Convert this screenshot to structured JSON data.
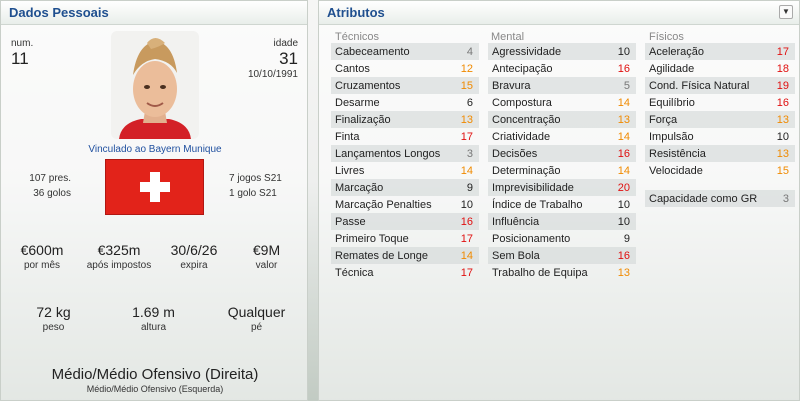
{
  "left": {
    "title": "Dados Pessoais",
    "num_label": "num.",
    "num": "11",
    "age_label": "idade",
    "age": "31",
    "dob": "10/10/1991",
    "club": "Vinculado ao Bayern Munique",
    "caps": "107 pres.",
    "goals": "36 golos",
    "u21_caps": "7 jogos S21",
    "u21_goals": "1 golo S21",
    "wage": "€600m",
    "wage_label": "por mês",
    "net": "€325m",
    "net_label": "após impostos",
    "expires": "30/6/26",
    "expires_label": "expira",
    "value": "€9M",
    "value_label": "valor",
    "weight": "72 kg",
    "weight_label": "peso",
    "height": "1.69 m",
    "height_label": "altura",
    "foot": "Qualquer",
    "foot_label": "pé",
    "position": "Médio/Médio Ofensivo (Direita)",
    "position2": "Médio/Médio Ofensivo (Esquerda)"
  },
  "right": {
    "title": "Atributos",
    "tecnicos": {
      "heading": "Técnicos",
      "items": [
        {
          "name": "Cabeceamento",
          "value": "4",
          "color": "grey"
        },
        {
          "name": "Cantos",
          "value": "12",
          "color": "orange"
        },
        {
          "name": "Cruzamentos",
          "value": "15",
          "color": "orange"
        },
        {
          "name": "Desarme",
          "value": "6",
          "color": "black"
        },
        {
          "name": "Finalização",
          "value": "13",
          "color": "orange"
        },
        {
          "name": "Finta",
          "value": "17",
          "color": "red"
        },
        {
          "name": "Lançamentos Longos",
          "value": "3",
          "color": "grey"
        },
        {
          "name": "Livres",
          "value": "14",
          "color": "orange"
        },
        {
          "name": "Marcação",
          "value": "9",
          "color": "black"
        },
        {
          "name": "Marcação Penalties",
          "value": "10",
          "color": "black"
        },
        {
          "name": "Passe",
          "value": "16",
          "color": "red"
        },
        {
          "name": "Primeiro Toque",
          "value": "17",
          "color": "red"
        },
        {
          "name": "Remates de Longe",
          "value": "14",
          "color": "orange"
        },
        {
          "name": "Técnica",
          "value": "17",
          "color": "red"
        }
      ]
    },
    "mental": {
      "heading": "Mental",
      "items": [
        {
          "name": "Agressividade",
          "value": "10",
          "color": "black"
        },
        {
          "name": "Antecipação",
          "value": "16",
          "color": "red"
        },
        {
          "name": "Bravura",
          "value": "5",
          "color": "grey"
        },
        {
          "name": "Compostura",
          "value": "14",
          "color": "orange"
        },
        {
          "name": "Concentração",
          "value": "13",
          "color": "orange"
        },
        {
          "name": "Criatividade",
          "value": "14",
          "color": "orange"
        },
        {
          "name": "Decisões",
          "value": "16",
          "color": "red"
        },
        {
          "name": "Determinação",
          "value": "14",
          "color": "orange"
        },
        {
          "name": "Imprevisibilidade",
          "value": "20",
          "color": "red"
        },
        {
          "name": "Índice de Trabalho",
          "value": "10",
          "color": "black"
        },
        {
          "name": "Influência",
          "value": "10",
          "color": "black"
        },
        {
          "name": "Posicionamento",
          "value": "9",
          "color": "black"
        },
        {
          "name": "Sem Bola",
          "value": "16",
          "color": "red"
        },
        {
          "name": "Trabalho de Equipa",
          "value": "13",
          "color": "orange"
        }
      ]
    },
    "fisicos": {
      "heading": "Físicos",
      "items": [
        {
          "name": "Aceleração",
          "value": "17",
          "color": "red"
        },
        {
          "name": "Agilidade",
          "value": "18",
          "color": "red"
        },
        {
          "name": "Cond. Física Natural",
          "value": "19",
          "color": "red"
        },
        {
          "name": "Equilíbrio",
          "value": "16",
          "color": "red"
        },
        {
          "name": "Força",
          "value": "13",
          "color": "orange"
        },
        {
          "name": "Impulsão",
          "value": "10",
          "color": "black"
        },
        {
          "name": "Resistência",
          "value": "13",
          "color": "orange"
        },
        {
          "name": "Velocidade",
          "value": "15",
          "color": "orange"
        }
      ]
    },
    "gk": {
      "name": "Capacidade como GR",
      "value": "3",
      "color": "grey"
    }
  },
  "colors": {
    "red": "#e01010",
    "orange": "#f08a00",
    "grey": "#777777",
    "black": "#222222",
    "title": "#1f4f8f"
  }
}
